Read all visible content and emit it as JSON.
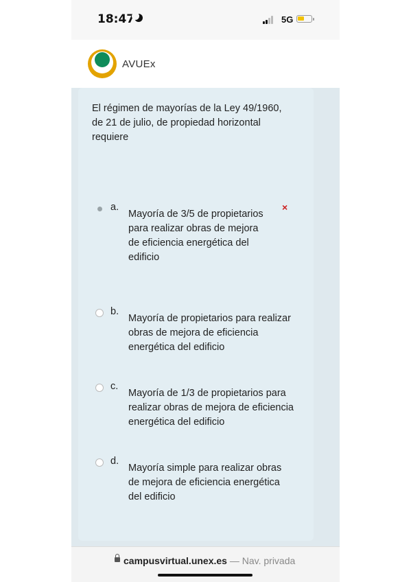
{
  "status_bar": {
    "time": "18:47",
    "network": "5G",
    "icons": [
      "moon-icon",
      "signal-icon",
      "battery-icon"
    ]
  },
  "header": {
    "brand": "AVUEx",
    "logo": "avuex-logo"
  },
  "question": {
    "text": "El régimen de mayorías de la Ley 49/1960, de 21 de julio, de propiedad horizontal requiere"
  },
  "options": [
    {
      "letter": "a.",
      "text": "Mayoría de 3/5 de propietarios para realizar obras de mejora de eficiencia energética del edificio",
      "selected": true,
      "mark": "×"
    },
    {
      "letter": "b.",
      "text": "Mayoría de propietarios para realizar obras de mejora de eficiencia energética del edificio",
      "selected": false
    },
    {
      "letter": "c.",
      "text": "Mayoría de 1/3 de propietarios para realizar obras de mejora de eficiencia energética del edificio",
      "selected": false
    },
    {
      "letter": "d.",
      "text": "Mayoría simple para realizar obras de mejora de eficiencia energética del edificio",
      "selected": false
    }
  ],
  "url_bar": {
    "domain": "campusvirtual.unex.es",
    "separator": "—",
    "mode": "Nav. privada"
  },
  "colors": {
    "wrong_mark": "#cc1f1f",
    "card_background": "#e3eef3",
    "logo_ring": "#e3a300",
    "logo_center": "#0f8c5a"
  }
}
